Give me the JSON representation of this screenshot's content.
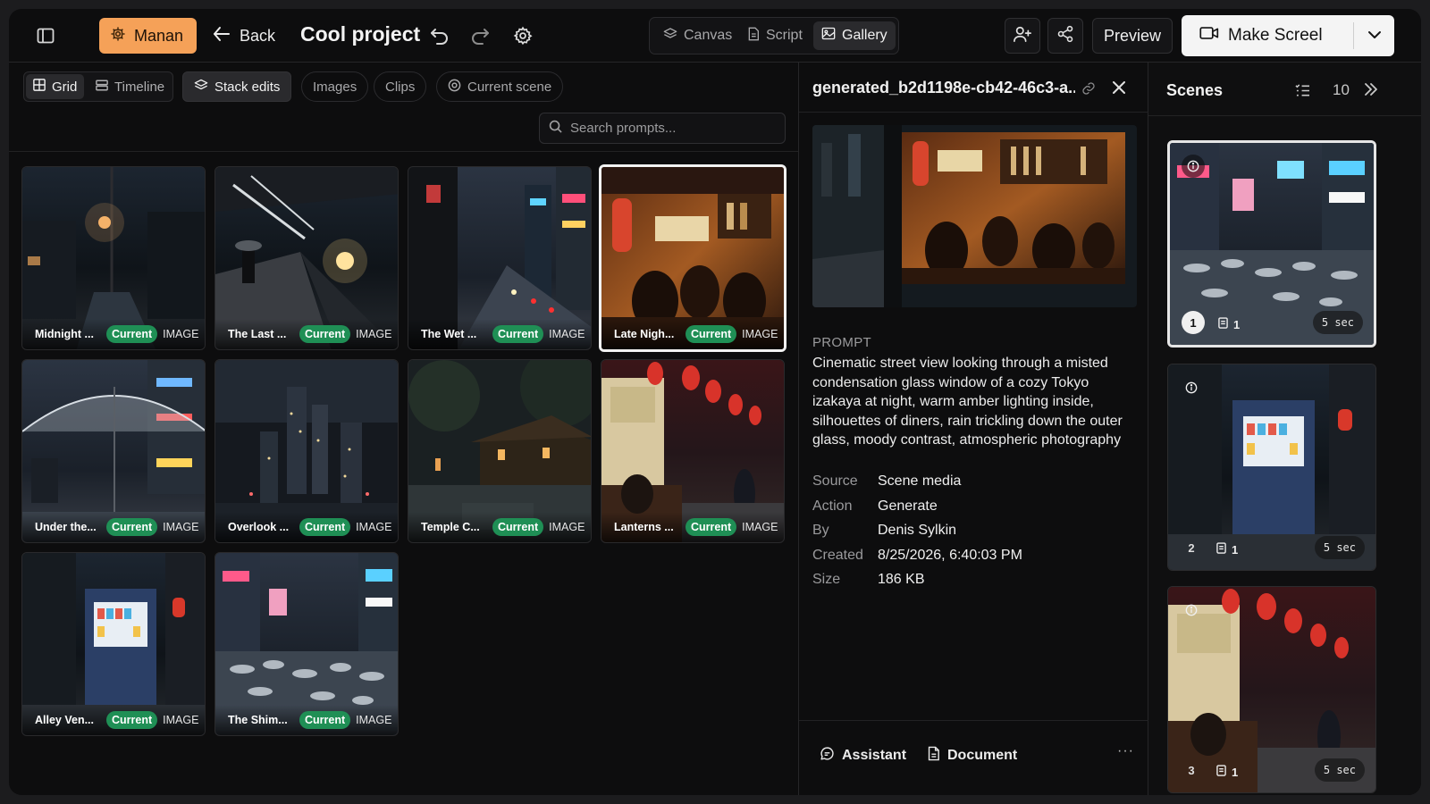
{
  "topbar": {
    "workspace_label": "Manan",
    "back_label": "Back",
    "project_title": "Cool project",
    "view_tabs": [
      {
        "label": "Canvas",
        "icon": "layers-icon",
        "active": false
      },
      {
        "label": "Script",
        "icon": "file-icon",
        "active": false
      },
      {
        "label": "Gallery",
        "icon": "images-icon",
        "active": true
      }
    ],
    "preview_label": "Preview",
    "make_label": "Make Screel"
  },
  "gallery": {
    "view_modes": [
      {
        "label": "Grid",
        "active": true
      },
      {
        "label": "Timeline",
        "active": false
      }
    ],
    "filters": {
      "stack_edits": "Stack edits",
      "images": "Images",
      "clips": "Clips",
      "current_scene": "Current scene"
    },
    "search_placeholder": "Search prompts...",
    "current_badge": "Current",
    "type_label": "IMAGE",
    "items": [
      {
        "name": "Midnight ...",
        "selected": false
      },
      {
        "name": "The Last ...",
        "selected": false
      },
      {
        "name": "The Wet ...",
        "selected": false
      },
      {
        "name": "Late Nigh...",
        "selected": true
      },
      {
        "name": "Under the...",
        "selected": false
      },
      {
        "name": "Overlook ...",
        "selected": false
      },
      {
        "name": "Temple C...",
        "selected": false
      },
      {
        "name": "Lanterns ...",
        "selected": false
      },
      {
        "name": "Alley Ven...",
        "selected": false
      },
      {
        "name": "The Shim...",
        "selected": false
      }
    ]
  },
  "detail": {
    "title": "generated_b2d1198e-cb42-46c3-a...",
    "prompt_heading": "PROMPT",
    "prompt": "Cinematic street view looking through a misted condensation glass window of a cozy Tokyo izakaya at night, warm amber lighting inside, silhouettes of diners, rain trickling down the outer glass, moody contrast, atmospheric photography",
    "meta": [
      {
        "key": "Source",
        "value": "Scene media"
      },
      {
        "key": "Action",
        "value": "Generate"
      },
      {
        "key": "By",
        "value": "Denis Sylkin"
      },
      {
        "key": "Created",
        "value": "8/25/2026, 6:40:03 PM"
      },
      {
        "key": "Size",
        "value": "186 KB"
      }
    ],
    "footer": {
      "assistant": "Assistant",
      "document": "Document",
      "more": "···"
    }
  },
  "scenes": {
    "title": "Scenes",
    "count": "10",
    "items": [
      {
        "number": "1",
        "clips": "1",
        "duration": "5 sec",
        "active": true
      },
      {
        "number": "2",
        "clips": "1",
        "duration": "5 sec",
        "active": false
      },
      {
        "number": "3",
        "clips": "1",
        "duration": "5 sec",
        "active": false
      }
    ]
  },
  "colors": {
    "accent_orange": "#f5a158",
    "current_green": "#1f8f55",
    "background": "#0d0d0e"
  }
}
